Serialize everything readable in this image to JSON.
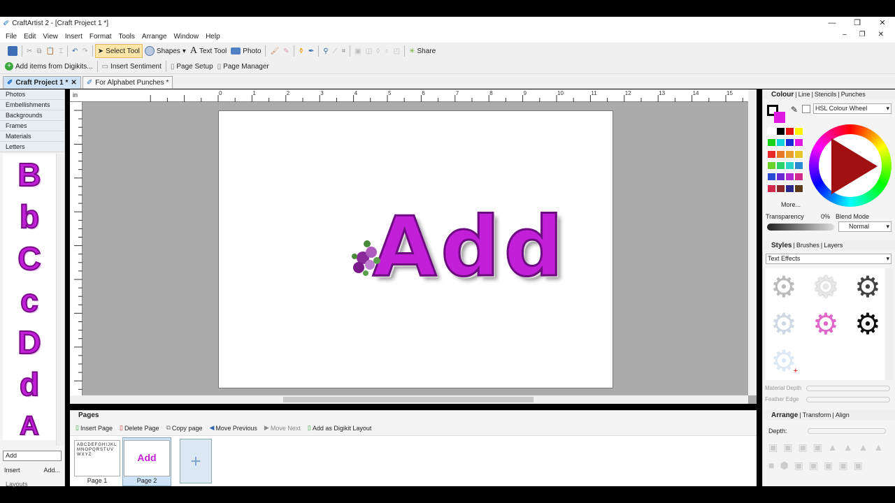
{
  "window": {
    "title": "CraftArtist 2 - [Craft Project 1 *]"
  },
  "menu": [
    "File",
    "Edit",
    "View",
    "Insert",
    "Format",
    "Tools",
    "Arrange",
    "Window",
    "Help"
  ],
  "toolbar": {
    "select_tool": "Select Tool",
    "shapes": "Shapes",
    "text_tool": "Text Tool",
    "photo": "Photo",
    "share": "Share"
  },
  "toolbar2": {
    "add_items": "Add items from Digikits...",
    "insert_sentiment": "Insert Sentiment",
    "page_setup": "Page Setup",
    "page_manager": "Page Manager"
  },
  "tabs": [
    {
      "label": "Craft Project 1 *"
    },
    {
      "label": "For Alphabet Punches *"
    }
  ],
  "left": {
    "categories": [
      "Photos",
      "Embellishments",
      "Backgrounds",
      "Frames",
      "Materials",
      "Letters"
    ],
    "letters": [
      "B",
      "b",
      "C",
      "c",
      "D",
      "d",
      "A"
    ],
    "search_value": "Add",
    "insert": "Insert",
    "add": "Add...",
    "layouts": "Layouts"
  },
  "canvas": {
    "ruler_unit": "in",
    "ruler_numbers": [
      "0",
      "1",
      "2",
      "3",
      "4",
      "5",
      "6",
      "7",
      "8",
      "9",
      "10",
      "11",
      "12",
      "13",
      "14",
      "15"
    ],
    "word": "Add"
  },
  "pages": {
    "title": "Pages",
    "insert_page": "Insert Page",
    "delete_page": "Delete Page",
    "copy_page": "Copy page",
    "move_previous": "Move Previous",
    "move_next": "Move Next",
    "add_digikit": "Add as Digikit Layout",
    "page1": "Page 1",
    "page2": "Page 2",
    "page1_text": "ABCDEFGHIJKLMNOPQRSTUVWXYZ",
    "page2_text": "Add"
  },
  "colour": {
    "tabs": [
      "Colour",
      "Line",
      "Stencils",
      "Punches"
    ],
    "mode": "HSL Colour Wheel",
    "more": "More...",
    "transparency": "Transparency",
    "transparency_value": "0%",
    "blend_mode": "Blend Mode",
    "blend_value": "Normal",
    "swatch_colors": [
      "#ffffff",
      "#000000",
      "#e3140f",
      "#fff200",
      "#19d219",
      "#14d2dc",
      "#1a2bd8",
      "#e01ae3",
      "#e82a2a",
      "#e8782a",
      "#e8a02a",
      "#e8c62a",
      "#6ad22a",
      "#2ad26a",
      "#2ad2c6",
      "#2a8ad2",
      "#2a4ad2",
      "#6a2ad2",
      "#b02ad2",
      "#d22a8a",
      "#d22a4a",
      "#8a2a2a",
      "#2a2a8a",
      "#5a3a1a"
    ]
  },
  "styles": {
    "tabs": [
      "Styles",
      "Brushes",
      "Layers"
    ],
    "category": "Text Effects",
    "material_depth": "Material Depth",
    "feather_edge": "Feather Edge"
  },
  "arrange": {
    "tabs": [
      "Arrange",
      "Transform",
      "Align"
    ],
    "depth": "Depth:"
  }
}
